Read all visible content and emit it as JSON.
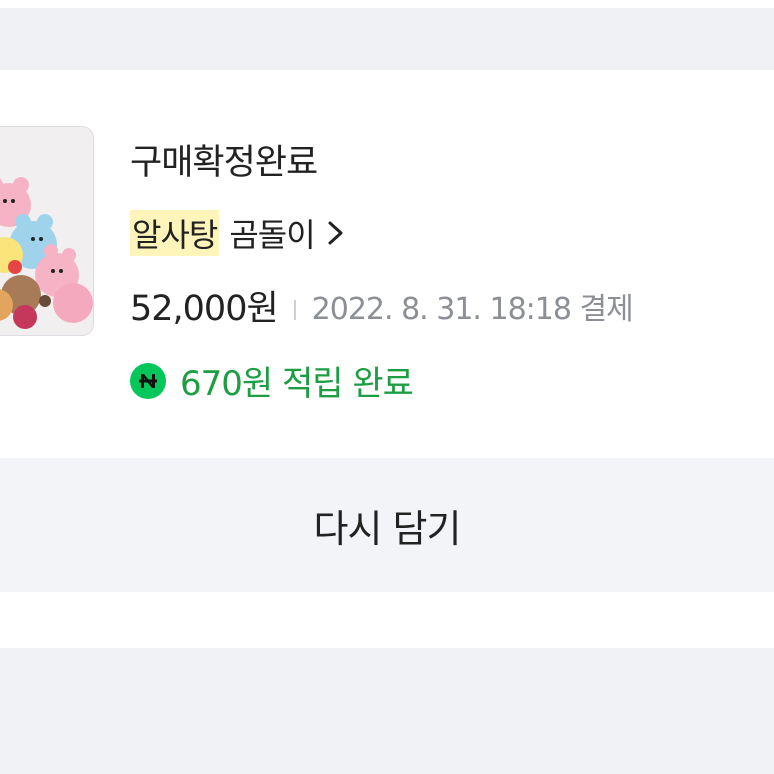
{
  "order": {
    "status": "구매확정완료",
    "store_name": "알사탕",
    "product_name": "곰돌이",
    "price": "52,000원",
    "pay_date": "2022. 8. 31. 18:18 결제",
    "points_text": "670원 적립 완료",
    "points_icon": "naverpay-n-icon"
  },
  "actions": {
    "rebuy_label": "다시 담기"
  },
  "colors": {
    "points_green": "#1e9e43",
    "npay_green": "#03c75a",
    "store_highlight": "#fff4b9"
  }
}
